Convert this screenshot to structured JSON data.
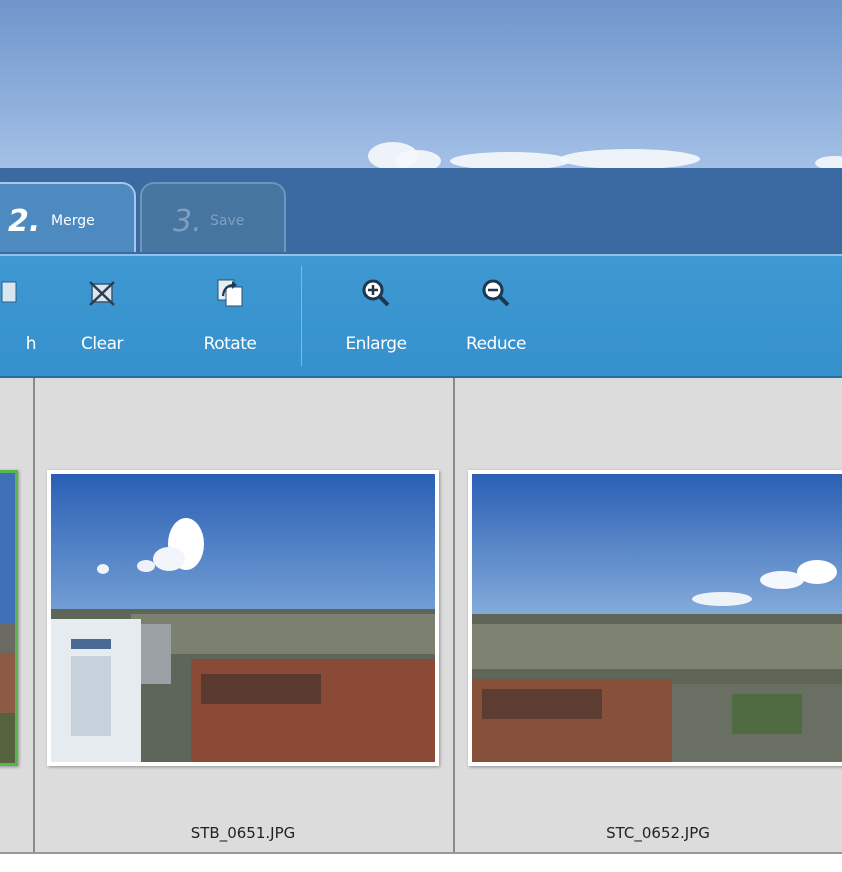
{
  "tabs": [
    {
      "number": "2.",
      "label": "Merge",
      "state": "active"
    },
    {
      "number": "3.",
      "label": "Save",
      "state": "disabled"
    }
  ],
  "toolbar": {
    "partial_label": "h",
    "clear_label": "Clear",
    "rotate_label": "Rotate",
    "enlarge_label": "Enlarge",
    "reduce_label": "Reduce"
  },
  "icons": {
    "clear": "clear-x-icon",
    "rotate": "rotate-icon",
    "enlarge": "zoom-in-icon",
    "reduce": "zoom-out-icon"
  },
  "images": [
    {
      "filename": "",
      "selected": true
    },
    {
      "filename": "STB_0651.JPG",
      "selected": false
    },
    {
      "filename": "STC_0652.JPG",
      "selected": false
    }
  ],
  "colors": {
    "tab_bar": "#3b6aa3",
    "toolbar": "#3893ce",
    "selection_border": "#54b948",
    "panel_bg": "#dcdcdc"
  }
}
